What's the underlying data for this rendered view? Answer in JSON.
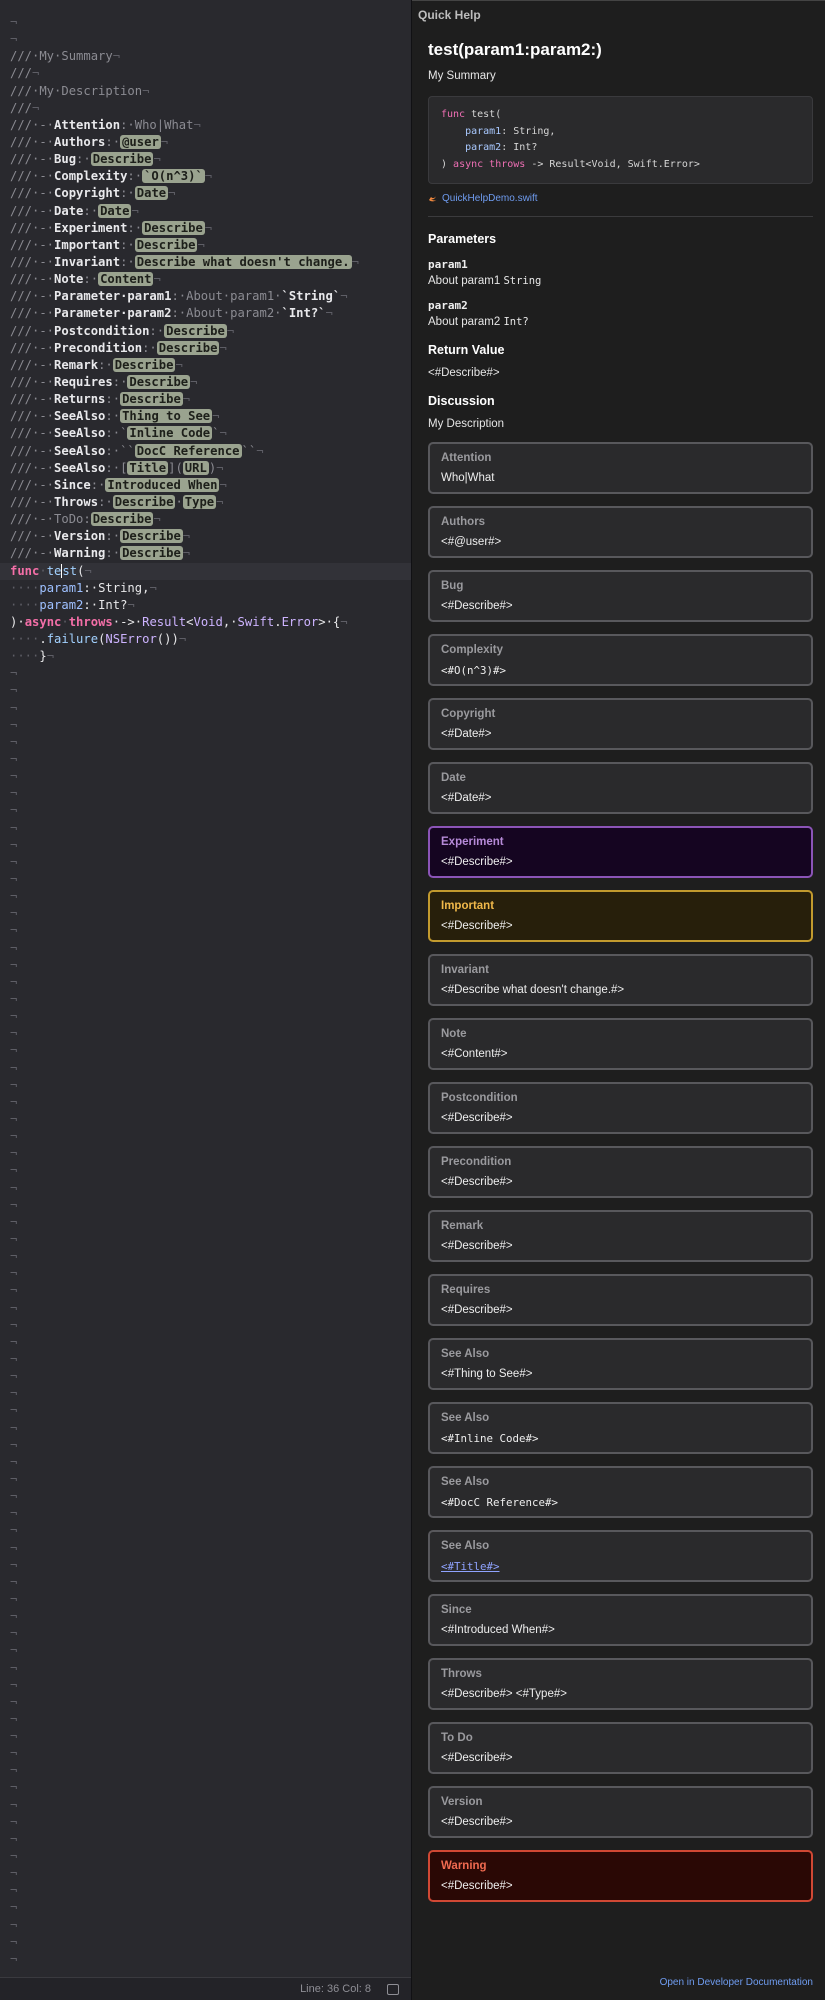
{
  "editor": {
    "status": "Line: 36  Col: 8",
    "lines": [
      [
        [
          "inv",
          "¬"
        ]
      ],
      [
        [
          "inv",
          "¬"
        ]
      ],
      [
        [
          "cmt",
          "///·My·Summary"
        ],
        [
          "inv",
          "¬"
        ]
      ],
      [
        [
          "cmt",
          "///"
        ],
        [
          "inv",
          "¬"
        ]
      ],
      [
        [
          "cmt",
          "///·My·Description"
        ],
        [
          "inv",
          "¬"
        ]
      ],
      [
        [
          "cmt",
          "///"
        ],
        [
          "inv",
          "¬"
        ]
      ],
      [
        [
          "cmt",
          "///·-·"
        ],
        [
          "cmt-kw",
          "Attention"
        ],
        [
          "cmt",
          ":·Who|What"
        ],
        [
          "inv",
          "¬"
        ]
      ],
      [
        [
          "cmt",
          "///·-·"
        ],
        [
          "cmt-kw",
          "Authors"
        ],
        [
          "cmt",
          ":·"
        ],
        [
          "ph",
          "@user"
        ],
        [
          "inv",
          "¬"
        ]
      ],
      [
        [
          "cmt",
          "///·-·"
        ],
        [
          "cmt-kw",
          "Bug"
        ],
        [
          "cmt",
          ":·"
        ],
        [
          "ph",
          "Describe"
        ],
        [
          "inv",
          "¬"
        ]
      ],
      [
        [
          "cmt",
          "///·-·"
        ],
        [
          "cmt-kw",
          "Complexity"
        ],
        [
          "cmt",
          ":·"
        ],
        [
          "ph",
          "`O(n^3)`"
        ],
        [
          "inv",
          "¬"
        ]
      ],
      [
        [
          "cmt",
          "///·-·"
        ],
        [
          "cmt-kw",
          "Copyright"
        ],
        [
          "cmt",
          ":·"
        ],
        [
          "ph",
          "Date"
        ],
        [
          "inv",
          "¬"
        ]
      ],
      [
        [
          "cmt",
          "///·-·"
        ],
        [
          "cmt-kw",
          "Date"
        ],
        [
          "cmt",
          ":·"
        ],
        [
          "ph",
          "Date"
        ],
        [
          "inv",
          "¬"
        ]
      ],
      [
        [
          "cmt",
          "///·-·"
        ],
        [
          "cmt-kw",
          "Experiment"
        ],
        [
          "cmt",
          ":·"
        ],
        [
          "ph",
          "Describe"
        ],
        [
          "inv",
          "¬"
        ]
      ],
      [
        [
          "cmt",
          "///·-·"
        ],
        [
          "cmt-kw",
          "Important"
        ],
        [
          "cmt",
          ":·"
        ],
        [
          "ph",
          "Describe"
        ],
        [
          "inv",
          "¬"
        ]
      ],
      [
        [
          "cmt",
          "///·-·"
        ],
        [
          "cmt-kw",
          "Invariant"
        ],
        [
          "cmt",
          ":·"
        ],
        [
          "ph",
          "Describe what doesn't change."
        ],
        [
          "inv",
          "¬"
        ]
      ],
      [
        [
          "cmt",
          "///·-·"
        ],
        [
          "cmt-kw",
          "Note"
        ],
        [
          "cmt",
          ":·"
        ],
        [
          "ph",
          "Content"
        ],
        [
          "inv",
          "¬"
        ]
      ],
      [
        [
          "cmt",
          "///·-·"
        ],
        [
          "cmt-kw",
          "Parameter·param1"
        ],
        [
          "cmt",
          ":·About·param1·"
        ],
        [
          "cmt-kw",
          "`String`"
        ],
        [
          "inv",
          "¬"
        ]
      ],
      [
        [
          "cmt",
          "///·-·"
        ],
        [
          "cmt-kw",
          "Parameter·param2"
        ],
        [
          "cmt",
          ":·About·param2·"
        ],
        [
          "cmt-kw",
          "`Int?`"
        ],
        [
          "inv",
          "¬"
        ]
      ],
      [
        [
          "cmt",
          "///·-·"
        ],
        [
          "cmt-kw",
          "Postcondition"
        ],
        [
          "cmt",
          ":·"
        ],
        [
          "ph",
          "Describe"
        ],
        [
          "inv",
          "¬"
        ]
      ],
      [
        [
          "cmt",
          "///·-·"
        ],
        [
          "cmt-kw",
          "Precondition"
        ],
        [
          "cmt",
          ":·"
        ],
        [
          "ph",
          "Describe"
        ],
        [
          "inv",
          "¬"
        ]
      ],
      [
        [
          "cmt",
          "///·-·"
        ],
        [
          "cmt-kw",
          "Remark"
        ],
        [
          "cmt",
          ":·"
        ],
        [
          "ph",
          "Describe"
        ],
        [
          "inv",
          "¬"
        ]
      ],
      [
        [
          "cmt",
          "///·-·"
        ],
        [
          "cmt-kw",
          "Requires"
        ],
        [
          "cmt",
          ":·"
        ],
        [
          "ph",
          "Describe"
        ],
        [
          "inv",
          "¬"
        ]
      ],
      [
        [
          "cmt",
          "///·-·"
        ],
        [
          "cmt-kw",
          "Returns"
        ],
        [
          "cmt",
          ":·"
        ],
        [
          "ph",
          "Describe"
        ],
        [
          "inv",
          "¬"
        ]
      ],
      [
        [
          "cmt",
          "///·-·"
        ],
        [
          "cmt-kw",
          "SeeAlso"
        ],
        [
          "cmt",
          ":·"
        ],
        [
          "ph",
          "Thing to See"
        ],
        [
          "inv",
          "¬"
        ]
      ],
      [
        [
          "cmt",
          "///·-·"
        ],
        [
          "cmt-kw",
          "SeeAlso"
        ],
        [
          "cmt",
          ":·`"
        ],
        [
          "ph",
          "Inline Code"
        ],
        [
          "cmt",
          "`"
        ],
        [
          "inv",
          "¬"
        ]
      ],
      [
        [
          "cmt",
          "///·-·"
        ],
        [
          "cmt-kw",
          "SeeAlso"
        ],
        [
          "cmt",
          ":·``"
        ],
        [
          "ph",
          "DocC Reference"
        ],
        [
          "cmt",
          "``"
        ],
        [
          "inv",
          "¬"
        ]
      ],
      [
        [
          "cmt",
          "///·-·"
        ],
        [
          "cmt-kw",
          "SeeAlso"
        ],
        [
          "cmt",
          ":·["
        ],
        [
          "ph",
          "Title"
        ],
        [
          "cmt",
          "]("
        ],
        [
          "ph",
          "URL"
        ],
        [
          "cmt",
          ")"
        ],
        [
          "inv",
          "¬"
        ]
      ],
      [
        [
          "cmt",
          "///·-·"
        ],
        [
          "cmt-kw",
          "Since"
        ],
        [
          "cmt",
          ":·"
        ],
        [
          "ph",
          "Introduced When"
        ],
        [
          "inv",
          "¬"
        ]
      ],
      [
        [
          "cmt",
          "///·-·"
        ],
        [
          "cmt-kw",
          "Throws"
        ],
        [
          "cmt",
          ":·"
        ],
        [
          "ph",
          "Describe"
        ],
        [
          "cmt",
          "·"
        ],
        [
          "ph",
          "Type"
        ],
        [
          "inv",
          "¬"
        ]
      ],
      [
        [
          "cmt",
          "///·-·ToDo:"
        ],
        [
          "ph",
          "Describe"
        ],
        [
          "inv",
          "¬"
        ]
      ],
      [
        [
          "cmt",
          "///·-·"
        ],
        [
          "cmt-kw",
          "Version"
        ],
        [
          "cmt",
          ":·"
        ],
        [
          "ph",
          "Describe"
        ],
        [
          "inv",
          "¬"
        ]
      ],
      [
        [
          "cmt",
          "///·-·"
        ],
        [
          "cmt-kw",
          "Warning"
        ],
        [
          "cmt",
          ":·"
        ],
        [
          "ph",
          "Describe"
        ],
        [
          "inv",
          "¬"
        ]
      ],
      [
        [
          "kw",
          "func"
        ],
        [
          "inv",
          "·"
        ],
        [
          "fn",
          "te"
        ],
        [
          "cursor",
          ""
        ],
        [
          "fn",
          "st"
        ],
        [
          "plain",
          "("
        ],
        [
          "inv",
          "¬"
        ]
      ],
      [
        [
          "inv",
          "····"
        ],
        [
          "pm",
          "param1"
        ],
        [
          "plain",
          ":·String,"
        ],
        [
          "inv",
          "¬"
        ]
      ],
      [
        [
          "inv",
          "····"
        ],
        [
          "pm",
          "param2"
        ],
        [
          "plain",
          ":·Int?"
        ],
        [
          "inv",
          "¬"
        ]
      ],
      [
        [
          "plain",
          ")·"
        ],
        [
          "kw",
          "async"
        ],
        [
          "inv",
          "·"
        ],
        [
          "kw",
          "throws"
        ],
        [
          "plain",
          "·->·"
        ],
        [
          "ty",
          "Result"
        ],
        [
          "plain",
          "<"
        ],
        [
          "ty",
          "Void"
        ],
        [
          "plain",
          ",·"
        ],
        [
          "ty",
          "Swift"
        ],
        [
          "plain",
          "."
        ],
        [
          "ty",
          "Error"
        ],
        [
          "plain",
          ">·{"
        ],
        [
          "inv",
          "¬"
        ]
      ],
      [
        [
          "inv",
          "····"
        ],
        [
          "plain",
          "."
        ],
        [
          "fn",
          "failure"
        ],
        [
          "plain",
          "("
        ],
        [
          "ty",
          "NSError"
        ],
        [
          "plain",
          "())"
        ],
        [
          "inv",
          "¬"
        ]
      ],
      [
        [
          "inv",
          "····"
        ],
        [
          "plain",
          "}"
        ],
        [
          "inv",
          "¬"
        ]
      ]
    ],
    "filler": "¬",
    "filler_count": 76
  },
  "quick_help": {
    "header": "Quick Help",
    "signature": "test(param1:param2:)",
    "summary": "My Summary",
    "declaration": {
      "l1_kw": "func",
      "l1_name": " test(",
      "l2_name": "    param1",
      "l2_type": ": String,",
      "l3_name": "    param2",
      "l3_type": ": Int?",
      "l4_a": ") ",
      "l4_kw": "async throws",
      "l4_b": " -> Result<Void, Swift.Error>"
    },
    "file": "QuickHelpDemo.swift",
    "parameters_heading": "Parameters",
    "param1_name": "param1",
    "param1_desc_text": "About param1 ",
    "param1_desc_code": "String",
    "param2_name": "param2",
    "param2_desc_text": "About param2 ",
    "param2_desc_code": "Int?",
    "return_heading": "Return Value",
    "return_value": "<#Describe#>",
    "discussion_heading": "Discussion",
    "discussion": "My Description",
    "asides": [
      {
        "title": "Attention",
        "body": "Who|What",
        "style": ""
      },
      {
        "title": "Authors",
        "body": "<#@user#>",
        "style": ""
      },
      {
        "title": "Bug",
        "body": "<#Describe#>",
        "style": ""
      },
      {
        "title": "Complexity",
        "body": "<#O(n^3)#>",
        "style": "",
        "mono": true
      },
      {
        "title": "Copyright",
        "body": "<#Date#>",
        "style": ""
      },
      {
        "title": "Date",
        "body": "<#Date#>",
        "style": ""
      },
      {
        "title": "Experiment",
        "body": "<#Describe#>",
        "style": "experiment"
      },
      {
        "title": "Important",
        "body": "<#Describe#>",
        "style": "important"
      },
      {
        "title": "Invariant",
        "body": "<#Describe what doesn't change.#>",
        "style": ""
      },
      {
        "title": "Note",
        "body": "<#Content#>",
        "style": ""
      },
      {
        "title": "Postcondition",
        "body": "<#Describe#>",
        "style": ""
      },
      {
        "title": "Precondition",
        "body": "<#Describe#>",
        "style": ""
      },
      {
        "title": "Remark",
        "body": "<#Describe#>",
        "style": ""
      },
      {
        "title": "Requires",
        "body": "<#Describe#>",
        "style": ""
      },
      {
        "title": "See Also",
        "body": "<#Thing to See#>",
        "style": ""
      },
      {
        "title": "See Also",
        "body": "<#Inline Code#>",
        "style": "",
        "mono": true
      },
      {
        "title": "See Also",
        "body": "<#DocC Reference#>",
        "style": "",
        "mono": true
      },
      {
        "title": "See Also",
        "body": "<#Title#>",
        "style": "",
        "link": true
      },
      {
        "title": "Since",
        "body": "<#Introduced When#>",
        "style": ""
      },
      {
        "title": "Throws",
        "body": "<#Describe#> <#Type#>",
        "style": ""
      },
      {
        "title": "To Do",
        "body": "<#Describe#>",
        "style": ""
      },
      {
        "title": "Version",
        "body": "<#Describe#>",
        "style": ""
      },
      {
        "title": "Warning",
        "body": "<#Describe#>",
        "style": "warning"
      }
    ],
    "open_docs": "Open in Developer Documentation"
  }
}
